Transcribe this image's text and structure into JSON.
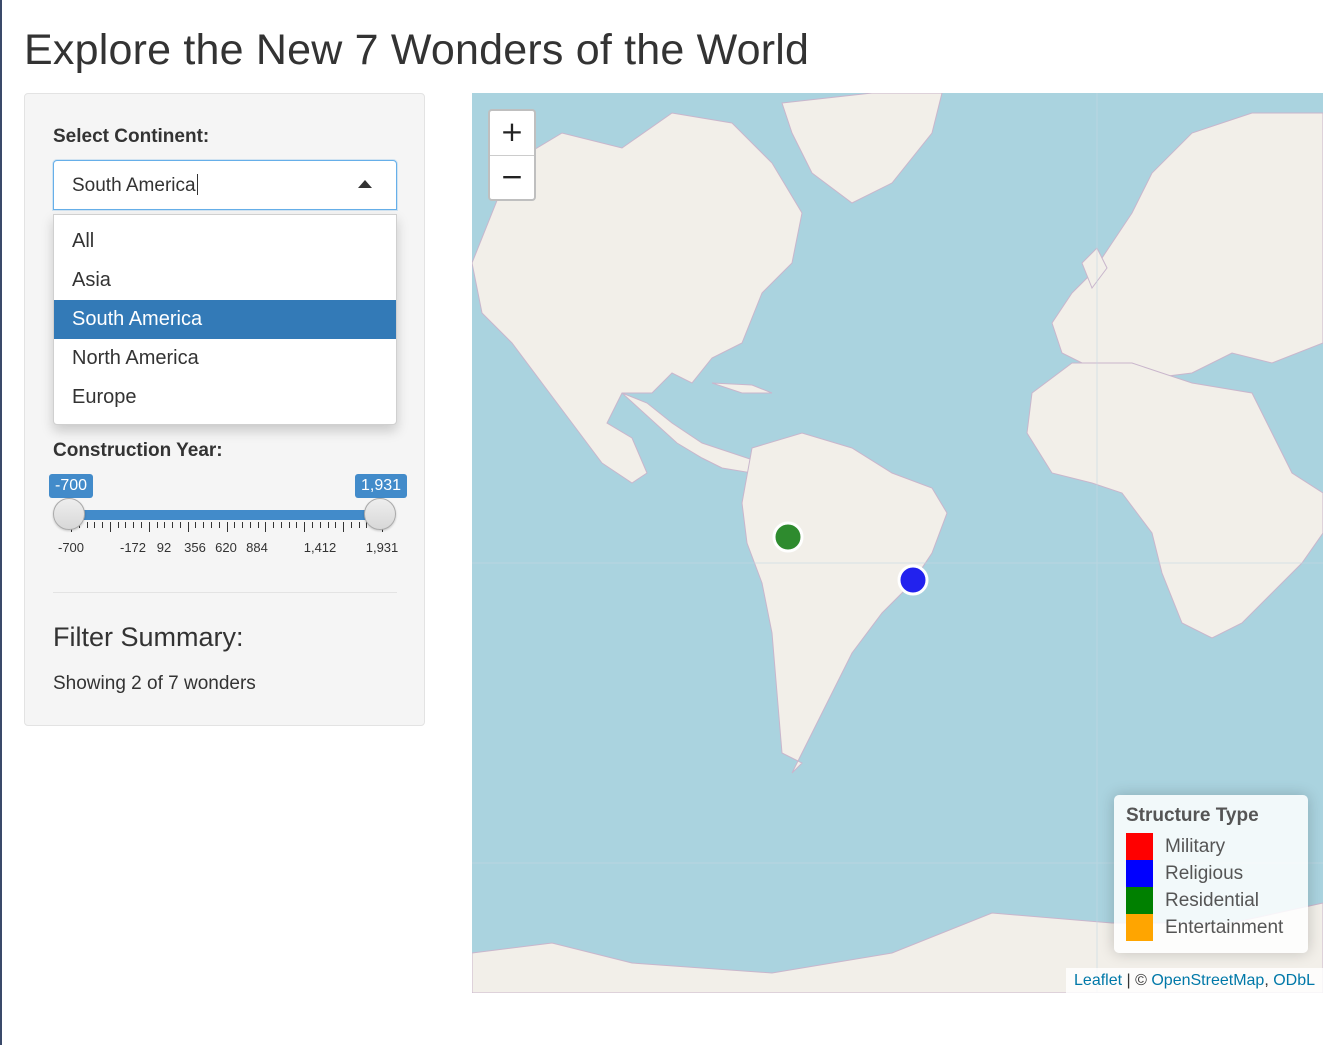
{
  "page": {
    "title": "Explore the New 7 Wonders of the World"
  },
  "sidebar": {
    "continent_label": "Select Continent:",
    "continent_value": "South America",
    "continent_options": [
      "All",
      "Asia",
      "South America",
      "North America",
      "Europe"
    ],
    "selected_option": "South America",
    "year_label": "Construction Year:",
    "year_min_badge": "-700",
    "year_max_badge": "1,931",
    "year_range": [
      -700,
      1931
    ],
    "tick_labels": [
      "-700",
      "-172",
      "92",
      "356",
      "620",
      "884",
      "1,412",
      "1,931"
    ],
    "summary_title": "Filter Summary:",
    "summary_text": "Showing 2 of 7 wonders"
  },
  "map": {
    "zoom_in": "+",
    "zoom_out": "−",
    "markers": [
      {
        "type": "Residential",
        "color": "#2e8b2e"
      },
      {
        "type": "Religious",
        "color": "#2222ee"
      }
    ],
    "legend": {
      "title": "Structure Type",
      "items": [
        {
          "label": "Military",
          "color": "#ff0000"
        },
        {
          "label": "Religious",
          "color": "#0000ff"
        },
        {
          "label": "Residential",
          "color": "#008000"
        },
        {
          "label": "Entertainment",
          "color": "#ffa500"
        }
      ]
    },
    "attribution": {
      "leaflet": "Leaflet",
      "sep": " | © ",
      "osm": "OpenStreetMap",
      "comma": ", ",
      "odbl": "ODbL"
    }
  }
}
